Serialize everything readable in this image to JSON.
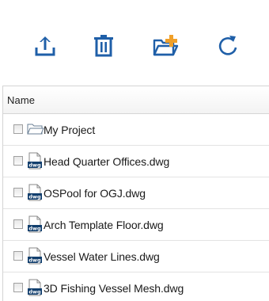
{
  "toolbar": {
    "buttons": [
      {
        "icon": "upload-icon"
      },
      {
        "icon": "trash-icon"
      },
      {
        "icon": "new-folder-icon"
      },
      {
        "icon": "refresh-icon"
      }
    ]
  },
  "colors": {
    "icon_blue": "#1f5fa8",
    "folder_accent": "#f0a02a",
    "dwg_badge": "#123f6e"
  },
  "list": {
    "header": {
      "name_label": "Name"
    },
    "items": [
      {
        "label": "My Project",
        "type": "folder",
        "icon": "folder-icon"
      },
      {
        "label": "Head Quarter Offices.dwg",
        "type": "dwg",
        "icon": "dwg-file-icon",
        "badge": "dwg"
      },
      {
        "label": "OSPool for OGJ.dwg",
        "type": "dwg",
        "icon": "dwg-file-icon",
        "badge": "dwg"
      },
      {
        "label": "Arch Template Floor.dwg",
        "type": "dwg",
        "icon": "dwg-file-icon",
        "badge": "dwg"
      },
      {
        "label": "Vessel Water Lines.dwg",
        "type": "dwg",
        "icon": "dwg-file-icon",
        "badge": "dwg"
      },
      {
        "label": "3D Fishing Vessel Mesh.dwg",
        "type": "dwg",
        "icon": "dwg-file-icon",
        "badge": "dwg"
      }
    ]
  }
}
